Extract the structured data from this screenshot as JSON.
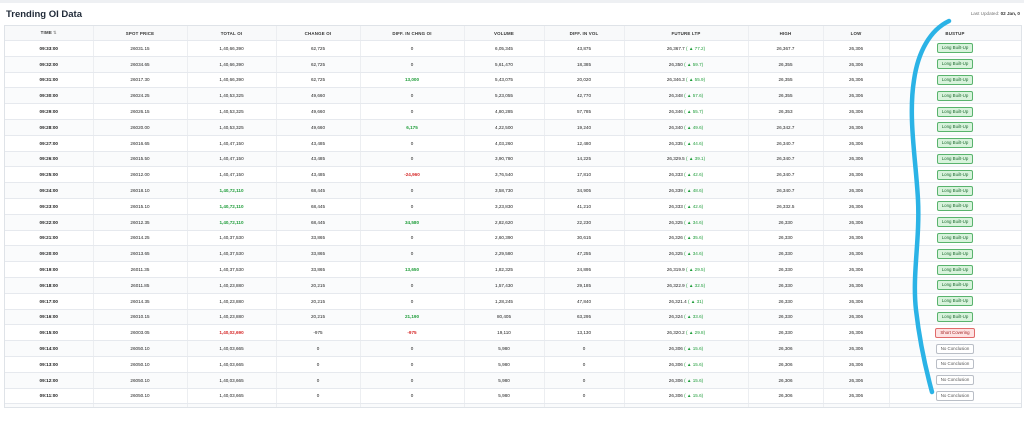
{
  "header": {
    "title": "Trending OI Data",
    "updated_label": "Last Updated:",
    "updated_value": "02 Jan, 0"
  },
  "columns": [
    "TIME",
    "SPOT PRICE",
    "TOTAL OI",
    "CHANGE OI",
    "DIFF. IN CHNG OI",
    "VOLUME",
    "DIFF. IN VOL",
    "FUTURE LTP",
    "HIGH",
    "LOW",
    "BUSTUP"
  ],
  "sort_icon": "sort-icon",
  "rows": [
    {
      "time": "09:33:00",
      "spot": "26031.15",
      "total_oi": "1,40,66,390",
      "change_oi": "62,725",
      "diff_chng_oi": "0",
      "diff_class": "",
      "volume": "6,05,345",
      "diff_vol": "43,875",
      "ltp": "26,367.7",
      "ltp_chg": "( ▲ 77.2)",
      "high": "26,367.7",
      "low": "26,306",
      "bustup": "Long Built-Up",
      "type": "long"
    },
    {
      "time": "09:32:00",
      "spot": "26034.65",
      "total_oi": "1,40,66,390",
      "change_oi": "62,725",
      "diff_chng_oi": "0",
      "diff_class": "",
      "volume": "5,61,470",
      "diff_vol": "18,385",
      "ltp": "26,350",
      "ltp_chg": "( ▲ 59.7)",
      "high": "26,355",
      "low": "26,306",
      "bustup": "Long Built-Up",
      "type": "long"
    },
    {
      "time": "09:31:00",
      "spot": "26017.30",
      "total_oi": "1,40,66,390",
      "change_oi": "62,725",
      "diff_chng_oi": "13,000",
      "diff_class": "pos",
      "volume": "5,43,075",
      "diff_vol": "20,020",
      "ltp": "26,346.3",
      "ltp_chg": "( ▲ 55.9)",
      "high": "26,355",
      "low": "26,306",
      "bustup": "Long Built-Up",
      "type": "long"
    },
    {
      "time": "09:30:00",
      "spot": "26024.25",
      "total_oi": "1,40,53,325",
      "change_oi": "49,660",
      "diff_chng_oi": "0",
      "diff_class": "",
      "volume": "5,23,055",
      "diff_vol": "42,770",
      "ltp": "26,348",
      "ltp_chg": "( ▲ 57.6)",
      "high": "26,355",
      "low": "26,306",
      "bustup": "Long Built-Up",
      "type": "long"
    },
    {
      "time": "09:29:00",
      "spot": "26026.15",
      "total_oi": "1,40,53,325",
      "change_oi": "49,660",
      "diff_chng_oi": "0",
      "diff_class": "",
      "volume": "4,80,285",
      "diff_vol": "57,785",
      "ltp": "26,346",
      "ltp_chg": "( ▲ 55.7)",
      "high": "26,353",
      "low": "26,306",
      "bustup": "Long Built-Up",
      "type": "long"
    },
    {
      "time": "09:28:00",
      "spot": "26020.00",
      "total_oi": "1,40,53,325",
      "change_oi": "49,660",
      "diff_chng_oi": "6,175",
      "diff_class": "pos",
      "volume": "4,22,500",
      "diff_vol": "19,240",
      "ltp": "26,340",
      "ltp_chg": "( ▲ 49.6)",
      "high": "26,342.7",
      "low": "26,306",
      "bustup": "Long Built-Up",
      "type": "long"
    },
    {
      "time": "09:27:00",
      "spot": "26016.65",
      "total_oi": "1,40,47,150",
      "change_oi": "43,485",
      "diff_chng_oi": "0",
      "diff_class": "",
      "volume": "4,03,260",
      "diff_vol": "12,480",
      "ltp": "26,335",
      "ltp_chg": "( ▲ 44.6)",
      "high": "26,340.7",
      "low": "26,306",
      "bustup": "Long Built-Up",
      "type": "long"
    },
    {
      "time": "09:26:00",
      "spot": "26015.50",
      "total_oi": "1,40,47,150",
      "change_oi": "43,485",
      "diff_chng_oi": "0",
      "diff_class": "",
      "volume": "3,90,780",
      "diff_vol": "14,225",
      "ltp": "26,329.5",
      "ltp_chg": "( ▲ 39.1)",
      "high": "26,340.7",
      "low": "26,306",
      "bustup": "Long Built-Up",
      "type": "long"
    },
    {
      "time": "09:25:00",
      "spot": "26012.00",
      "total_oi": "1,40,47,150",
      "change_oi": "43,485",
      "diff_chng_oi": "-24,960",
      "diff_class": "neg",
      "volume": "3,76,540",
      "diff_vol": "17,810",
      "ltp": "26,333",
      "ltp_chg": "( ▲ 42.6)",
      "high": "26,340.7",
      "low": "26,306",
      "bustup": "Long Built-Up",
      "type": "long"
    },
    {
      "time": "09:24:00",
      "spot": "26018.10",
      "total_oi": "1,40,72,110",
      "change_oi": "68,445",
      "diff_chng_oi": "0",
      "diff_class": "",
      "volume": "3,58,730",
      "diff_vol": "34,905",
      "ltp": "26,339",
      "ltp_chg": "( ▲ 48.6)",
      "high": "26,340.7",
      "low": "26,306",
      "bustup": "Long Built-Up",
      "type": "long"
    },
    {
      "time": "09:23:00",
      "spot": "26015.10",
      "total_oi": "1,40,72,110",
      "change_oi": "68,445",
      "diff_chng_oi": "0",
      "diff_class": "",
      "volume": "3,23,830",
      "diff_vol": "41,210",
      "ltp": "26,333",
      "ltp_chg": "( ▲ 42.6)",
      "high": "26,332.5",
      "low": "26,306",
      "bustup": "Long Built-Up",
      "type": "long"
    },
    {
      "time": "09:22:00",
      "spot": "26012.35",
      "total_oi": "1,40,72,110",
      "change_oi": "68,445",
      "diff_chng_oi": "34,580",
      "diff_class": "pos",
      "volume": "2,82,620",
      "diff_vol": "22,230",
      "ltp": "26,325",
      "ltp_chg": "( ▲ 34.6)",
      "high": "26,330",
      "low": "26,306",
      "bustup": "Long Built-Up",
      "type": "long"
    },
    {
      "time": "09:21:00",
      "spot": "26014.25",
      "total_oi": "1,40,37,530",
      "change_oi": "33,865",
      "diff_chng_oi": "0",
      "diff_class": "",
      "volume": "2,60,390",
      "diff_vol": "30,615",
      "ltp": "26,326",
      "ltp_chg": "( ▲ 35.6)",
      "high": "26,330",
      "low": "26,306",
      "bustup": "Long Built-Up",
      "type": "long"
    },
    {
      "time": "09:20:00",
      "spot": "26013.65",
      "total_oi": "1,40,37,530",
      "change_oi": "33,865",
      "diff_chng_oi": "0",
      "diff_class": "",
      "volume": "2,29,580",
      "diff_vol": "47,255",
      "ltp": "26,325",
      "ltp_chg": "( ▲ 34.6)",
      "high": "26,330",
      "low": "26,306",
      "bustup": "Long Built-Up",
      "type": "long"
    },
    {
      "time": "09:19:00",
      "spot": "26011.35",
      "total_oi": "1,40,37,530",
      "change_oi": "33,865",
      "diff_chng_oi": "13,650",
      "diff_class": "pos",
      "volume": "1,82,325",
      "diff_vol": "24,895",
      "ltp": "26,319.9",
      "ltp_chg": "( ▲ 29.5)",
      "high": "26,330",
      "low": "26,306",
      "bustup": "Long Built-Up",
      "type": "long"
    },
    {
      "time": "09:18:00",
      "spot": "26011.85",
      "total_oi": "1,40,23,880",
      "change_oi": "20,215",
      "diff_chng_oi": "0",
      "diff_class": "",
      "volume": "1,57,430",
      "diff_vol": "29,185",
      "ltp": "26,322.9",
      "ltp_chg": "( ▲ 32.5)",
      "high": "26,330",
      "low": "26,306",
      "bustup": "Long Built-Up",
      "type": "long"
    },
    {
      "time": "09:17:00",
      "spot": "26014.35",
      "total_oi": "1,40,23,880",
      "change_oi": "20,215",
      "diff_chng_oi": "0",
      "diff_class": "",
      "volume": "1,28,245",
      "diff_vol": "47,840",
      "ltp": "26,321.4",
      "ltp_chg": "( ▲ 31)",
      "high": "26,330",
      "low": "26,306",
      "bustup": "Long Built-Up",
      "type": "long"
    },
    {
      "time": "09:16:00",
      "spot": "26010.15",
      "total_oi": "1,40,23,880",
      "change_oi": "20,215",
      "diff_chng_oi": "21,190",
      "diff_class": "pos",
      "volume": "80,405",
      "diff_vol": "63,295",
      "ltp": "26,324",
      "ltp_chg": "( ▲ 33.6)",
      "high": "26,330",
      "low": "26,306",
      "bustup": "Long Built-Up",
      "type": "long"
    },
    {
      "time": "09:15:00",
      "spot": "26003.05",
      "total_oi": "1,40,02,690",
      "change_oi": "-975",
      "diff_chng_oi": "-975",
      "diff_class": "neg",
      "volume": "19,110",
      "diff_vol": "13,130",
      "ltp": "26,320.2",
      "ltp_chg": "( ▲ 29.8)",
      "high": "26,330",
      "low": "26,306",
      "bustup": "Short Covering",
      "type": "short"
    },
    {
      "time": "09:14:00",
      "spot": "26050.10",
      "total_oi": "1,40,03,665",
      "change_oi": "0",
      "diff_chng_oi": "0",
      "diff_class": "",
      "volume": "5,980",
      "diff_vol": "0",
      "ltp": "26,306",
      "ltp_chg": "( ▲ 15.6)",
      "high": "26,306",
      "low": "26,306",
      "bustup": "No Conclusion",
      "type": "none"
    },
    {
      "time": "09:13:00",
      "spot": "26050.10",
      "total_oi": "1,40,03,665",
      "change_oi": "0",
      "diff_chng_oi": "0",
      "diff_class": "",
      "volume": "5,980",
      "diff_vol": "0",
      "ltp": "26,306",
      "ltp_chg": "( ▲ 15.6)",
      "high": "26,306",
      "low": "26,306",
      "bustup": "No Conclusion",
      "type": "none"
    },
    {
      "time": "09:12:00",
      "spot": "26050.10",
      "total_oi": "1,40,03,665",
      "change_oi": "0",
      "diff_chng_oi": "0",
      "diff_class": "",
      "volume": "5,980",
      "diff_vol": "0",
      "ltp": "26,306",
      "ltp_chg": "( ▲ 15.6)",
      "high": "26,306",
      "low": "26,306",
      "bustup": "No Conclusion",
      "type": "none"
    },
    {
      "time": "09:11:00",
      "spot": "26050.10",
      "total_oi": "1,40,03,665",
      "change_oi": "0",
      "diff_chng_oi": "0",
      "diff_class": "",
      "volume": "5,980",
      "diff_vol": "0",
      "ltp": "26,306",
      "ltp_chg": "( ▲ 15.6)",
      "high": "26,306",
      "low": "26,306",
      "bustup": "No Conclusion",
      "type": "none"
    },
    {
      "time": "09:10:00",
      "spot": "26050.10",
      "total_oi": "1,40,03,665",
      "change_oi": "0",
      "diff_chng_oi": "0",
      "diff_class": "",
      "volume": "5,980",
      "diff_vol": "0",
      "ltp": "26,306",
      "ltp_chg": "( ▲ 15.6)",
      "high": "26,306",
      "low": "26,306",
      "bustup": "No Conclusion",
      "type": "none"
    }
  ],
  "annotation": {
    "name": "hand-drawn-blue-stroke",
    "color": "#2bb3e6"
  },
  "colors": {
    "positive": "#1f9d3a",
    "negative": "#d62828",
    "long_badge_bg": "#d8f3dc",
    "short_badge_bg": "#fde2e2"
  }
}
